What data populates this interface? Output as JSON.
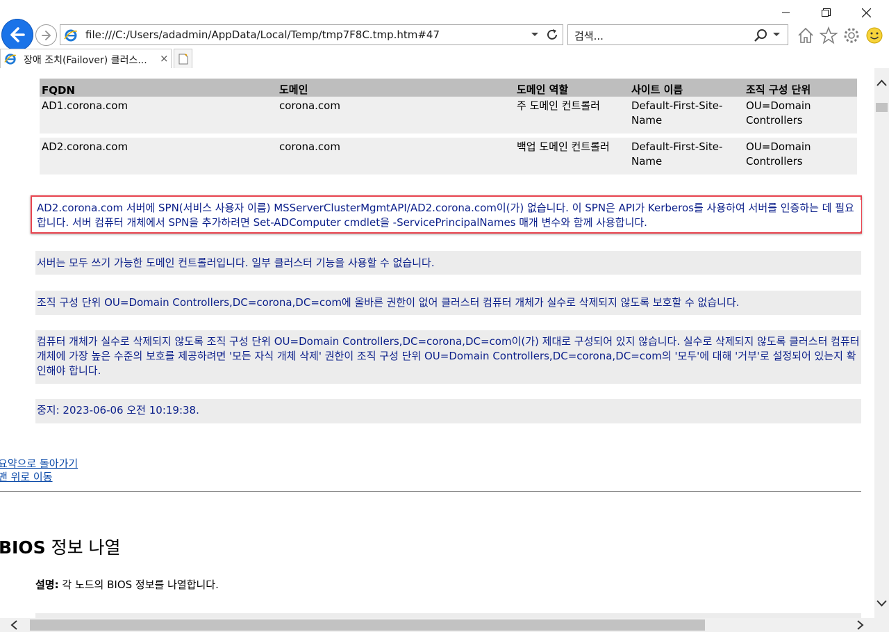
{
  "window": {
    "minimize_icon": "minimize-icon",
    "restore_icon": "restore-icon",
    "close_icon": "close-icon"
  },
  "address_bar": {
    "url": "file:///C:/Users/adadmin/AppData/Local/Temp/tmp7F8C.tmp.htm#47"
  },
  "search_box": {
    "placeholder": "검색..."
  },
  "tab": {
    "title": "장애 조치(Failover) 클러스...",
    "close_label": "×"
  },
  "dc_table": {
    "headers": [
      "FQDN",
      "도메인",
      "도메인 역할",
      "사이트 이름",
      "조직 구성 단위"
    ],
    "rows": [
      [
        "AD1.corona.com",
        "corona.com",
        "주 도메인 컨트롤러",
        "Default-First-Site-Name",
        "OU=Domain Controllers"
      ],
      [
        "AD2.corona.com",
        "corona.com",
        "백업 도메인 컨트롤러",
        "Default-First-Site-Name",
        "OU=Domain Controllers"
      ]
    ]
  },
  "messages": [
    "AD2.corona.com 서버에 SPN(서비스 사용자 이름) MSServerClusterMgmtAPI/AD2.corona.com이(가) 없습니다. 이 SPN은 API가 Kerberos를 사용하여 서버를 인증하는 데 필요합니다. 서버 컴퓨터 개체에서 SPN을 추가하려면 Set-ADComputer cmdlet을 -ServicePrincipalNames 매개 변수와 함께 사용합니다.",
    "서버는 모두 쓰기 가능한 도메인 컨트롤러입니다. 일부 클러스터 기능을 사용할 수 없습니다.",
    "조직 구성 단위 OU=Domain Controllers,DC=corona,DC=com에 올바른 권한이 없어 클러스터 컴퓨터 개체가 실수로 삭제되지 않도록 보호할 수 없습니다.",
    "컴퓨터 개체가 실수로 삭제되지 않도록 조직 구성 단위 OU=Domain Controllers,DC=corona,DC=com이(가) 제대로 구성되어 있지 않습니다. 실수로 삭제되지 않도록 클러스터 컴퓨터 개체에 가장 높은 수준의 보호를 제공하려면 '모든 자식 개체 삭제' 권한이 조직 구성 단위 OU=Domain Controllers,DC=corona,DC=com의 '모두'에 대해 '거부'로 설정되어 있는지 확인해야 합니다.",
    "중지: 2023-06-06 오전 10:19:38."
  ],
  "links": {
    "back_to_summary": "요약으로 돌아가기",
    "go_to_top": "맨 위로 이동"
  },
  "section": {
    "heading_bold": "BIOS",
    "heading_rest": " 정보 나열",
    "desc_label": "설명:",
    "desc_text": " 각 노드의 BIOS 정보를 나열합니다."
  },
  "colors": {
    "message_text": "#0b1f8a",
    "highlight_border": "#e8434e",
    "table_header": "#bebebe",
    "row_bg": "#efefef"
  }
}
